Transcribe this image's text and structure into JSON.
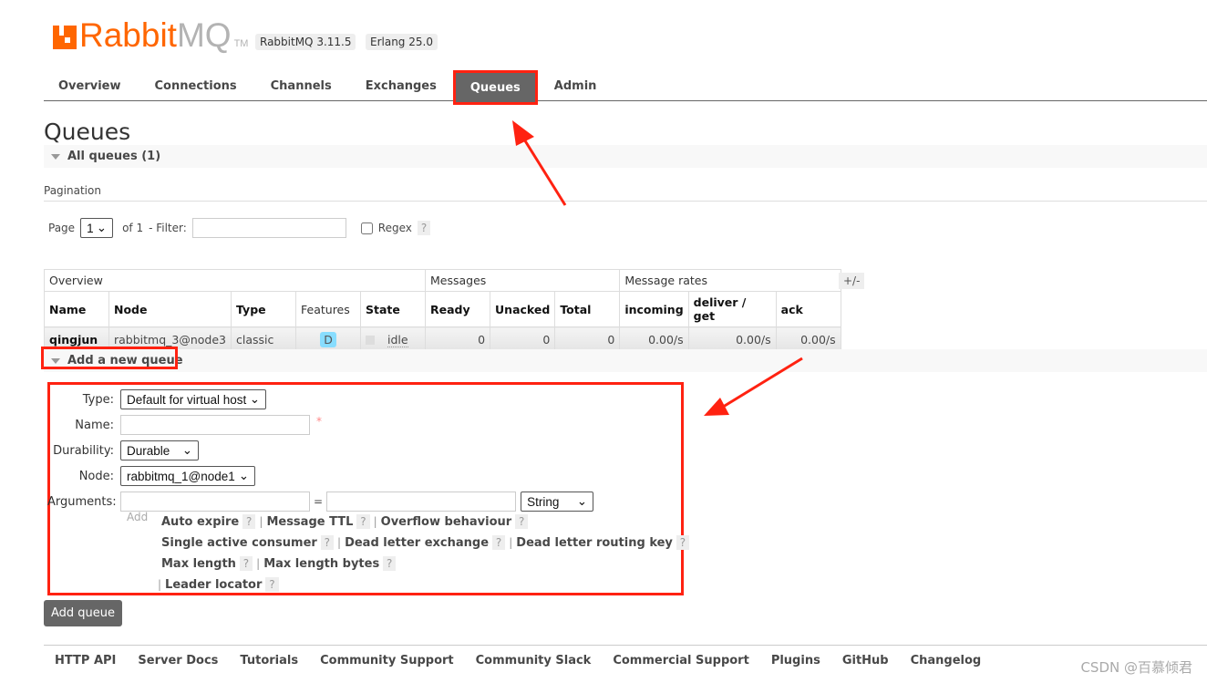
{
  "logo": {
    "text_orange": "Rabbit",
    "text_grey": "MQ",
    "tm": "TM"
  },
  "versions": [
    "RabbitMQ 3.11.5",
    "Erlang 25.0"
  ],
  "nav": [
    "Overview",
    "Connections",
    "Channels",
    "Exchanges",
    "Queues",
    "Admin"
  ],
  "nav_active": "Queues",
  "page_title": "Queues",
  "all_queues": "All queues (1)",
  "pagination": {
    "heading": "Pagination",
    "page_label": "Page",
    "page_value": "1",
    "of": "of 1",
    "filter_label": "- Filter:",
    "filter_value": "",
    "regex_label": "Regex",
    "help": "?"
  },
  "table": {
    "groups": [
      "Overview",
      "Messages",
      "Message rates"
    ],
    "plus_minus": "+/-",
    "columns": [
      "Name",
      "Node",
      "Type",
      "Features",
      "State",
      "Ready",
      "Unacked",
      "Total",
      "incoming",
      "deliver / get",
      "ack"
    ],
    "rows": [
      {
        "name": "qingjun",
        "node": "rabbitmq_3@node3",
        "type": "classic",
        "features": "D",
        "state": "idle",
        "ready": "0",
        "unacked": "0",
        "total": "0",
        "incoming": "0.00/s",
        "deliver_get": "0.00/s",
        "ack": "0.00/s"
      }
    ]
  },
  "add_queue": {
    "heading": "Add a new queue",
    "type_label": "Type:",
    "type_value": "Default for virtual host",
    "name_label": "Name:",
    "name_value": "",
    "required": "*",
    "durability_label": "Durability:",
    "durability_value": "Durable",
    "node_label": "Node:",
    "node_value": "rabbitmq_1@node1",
    "arguments_label": "Arguments:",
    "equals": "=",
    "arg_type": "String",
    "add": "Add",
    "args": [
      "Auto expire",
      "Message TTL",
      "Overflow behaviour",
      "Single active consumer",
      "Dead letter exchange",
      "Dead letter routing key",
      "Max length",
      "Max length bytes",
      "Leader locator"
    ],
    "button": "Add queue"
  },
  "footer": [
    "HTTP API",
    "Server Docs",
    "Tutorials",
    "Community Support",
    "Community Slack",
    "Commercial Support",
    "Plugins",
    "GitHub",
    "Changelog"
  ],
  "watermark": "CSDN @百慕倾君",
  "colors": {
    "accent": "#ff6600",
    "highlight": "#ff2211",
    "active_tab": "#666666"
  }
}
